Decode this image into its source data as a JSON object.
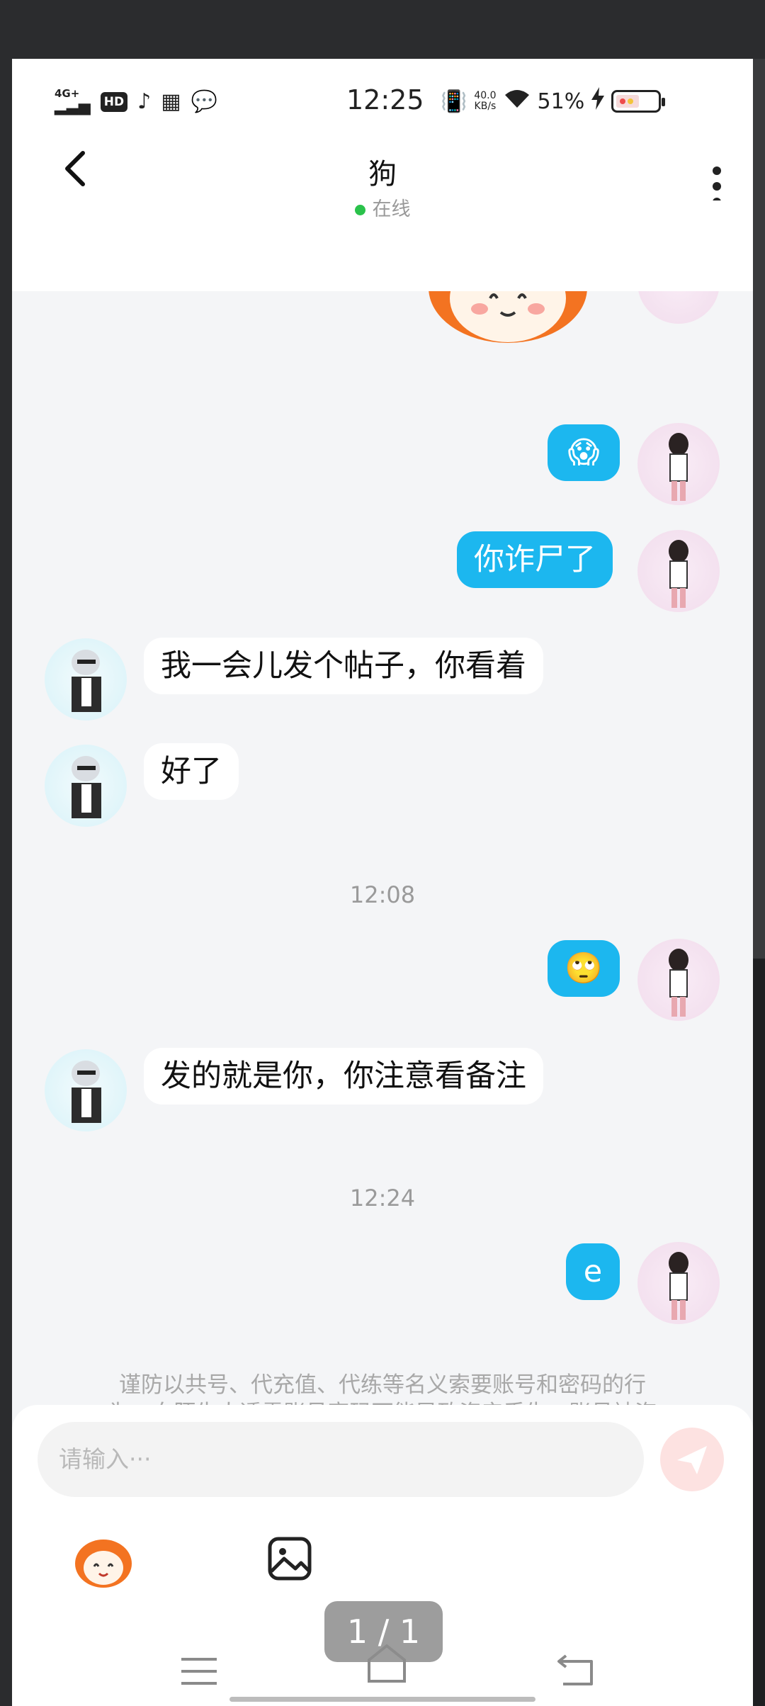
{
  "status_bar": {
    "signal": "4G+",
    "hd": "HD",
    "time": "12:25",
    "net_speed_value": "40.0",
    "net_speed_unit": "KB/s",
    "battery": "51%"
  },
  "header": {
    "title": "狗",
    "status": "在线"
  },
  "messages": [
    {
      "side": "out",
      "kind": "emoji",
      "text": "😱"
    },
    {
      "side": "out",
      "kind": "text",
      "text": "你诈尸了"
    },
    {
      "side": "in",
      "kind": "text",
      "text": "我一会儿发个帖子，你看着"
    },
    {
      "side": "in",
      "kind": "text",
      "text": "好了"
    },
    {
      "side": "out",
      "kind": "emoji",
      "text": "🙄"
    },
    {
      "side": "in",
      "kind": "text",
      "text": "发的就是你，你注意看备注"
    },
    {
      "side": "out",
      "kind": "text",
      "text": "e"
    }
  ],
  "timestamps": [
    "12:08",
    "12:24"
  ],
  "notice": {
    "line1": "谨防以共号、代充值、代练等名义索要账号和密码的行",
    "line2": "为，向陌生人透露账号密码可能导致资产丢失，账号被盗"
  },
  "input": {
    "placeholder": "请输入···"
  },
  "pager": "1 / 1",
  "colors": {
    "outgoing_bubble": "#1cb7ef",
    "incoming_bubble": "#ffffff",
    "online_dot": "#2ac24b",
    "send_button": "#fde2e1"
  }
}
